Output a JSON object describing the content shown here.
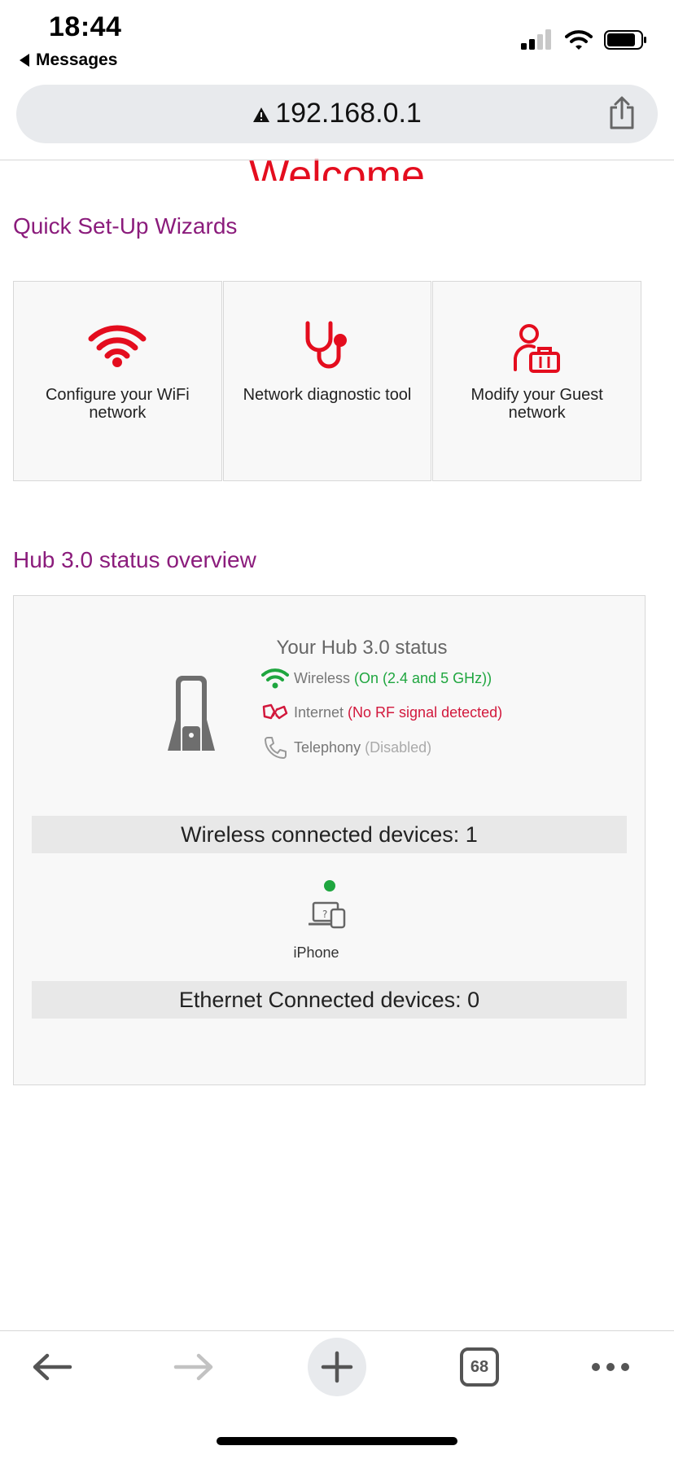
{
  "status_bar": {
    "time": "18:44",
    "back_app": "Messages"
  },
  "browser": {
    "url": "192.168.0.1",
    "tabs_count": "68"
  },
  "page": {
    "welcome": "Welcome",
    "wizards_title": "Quick Set-Up Wizards",
    "wizards": [
      {
        "label": "Configure your WiFi network",
        "icon": "wifi-icon"
      },
      {
        "label": "Network diagnostic tool",
        "icon": "stethoscope-icon"
      },
      {
        "label": "Modify your Guest network",
        "icon": "guest-user-icon"
      }
    ],
    "status_title": "Hub 3.0 status overview",
    "hub": {
      "title": "Your Hub 3.0 status",
      "rows": [
        {
          "label": "Wireless",
          "value": "(On (2.4 and 5 GHz))",
          "color": "#1fa63f",
          "icon": "wifi-icon"
        },
        {
          "label": "Internet",
          "value": "(No RF signal detected)",
          "color": "#d2183c",
          "icon": "disconnected-plug-icon"
        },
        {
          "label": "Telephony",
          "value": "(Disabled)",
          "color": "#999999",
          "icon": "phone-icon"
        }
      ],
      "wireless_devices": "Wireless connected devices: 1",
      "device_name": "iPhone",
      "ethernet_devices": "Ethernet Connected devices: 0"
    }
  },
  "colors": {
    "brand_red": "#e40d1e",
    "heading_purple": "#8b1c7c",
    "online_green": "#1fa63f"
  }
}
